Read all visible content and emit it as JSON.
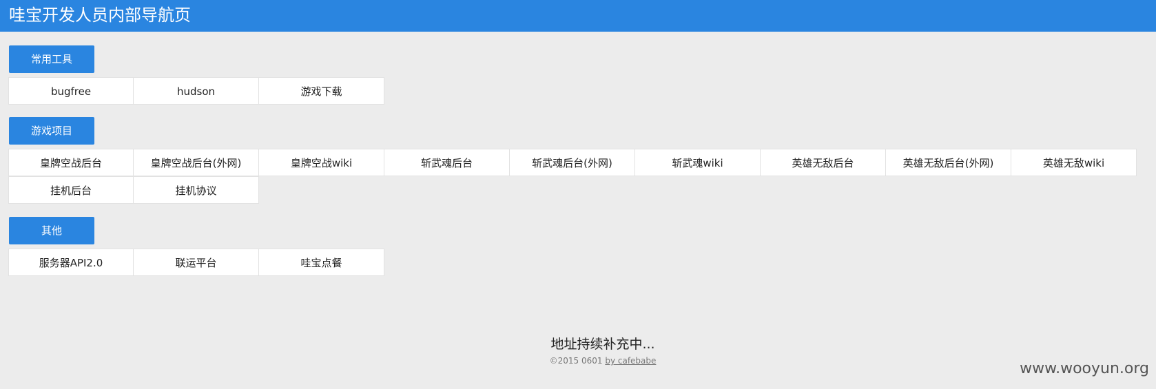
{
  "header": {
    "title": "哇宝开发人员内部导航页"
  },
  "sections": {
    "tools": {
      "label": "常用工具",
      "links": [
        "bugfree",
        "hudson",
        "游戏下载"
      ]
    },
    "games": {
      "label": "游戏项目",
      "links": [
        "皇牌空战后台",
        "皇牌空战后台(外网)",
        "皇牌空战wiki",
        "斩武魂后台",
        "斩武魂后台(外网)",
        "斩武魂wiki",
        "英雄无敌后台",
        "英雄无敌后台(外网)",
        "英雄无敌wiki",
        "挂机后台",
        "挂机协议"
      ]
    },
    "other": {
      "label": "其他",
      "links": [
        "服务器API2.0",
        "联运平台",
        "哇宝点餐"
      ]
    }
  },
  "footer": {
    "main": "地址持续补充中...",
    "copyright": "©2015 0601",
    "author_link": "by cafebabe"
  },
  "watermark": "www.wooyun.org",
  "colors": {
    "accent": "#2a85e0",
    "background": "#ececec"
  }
}
